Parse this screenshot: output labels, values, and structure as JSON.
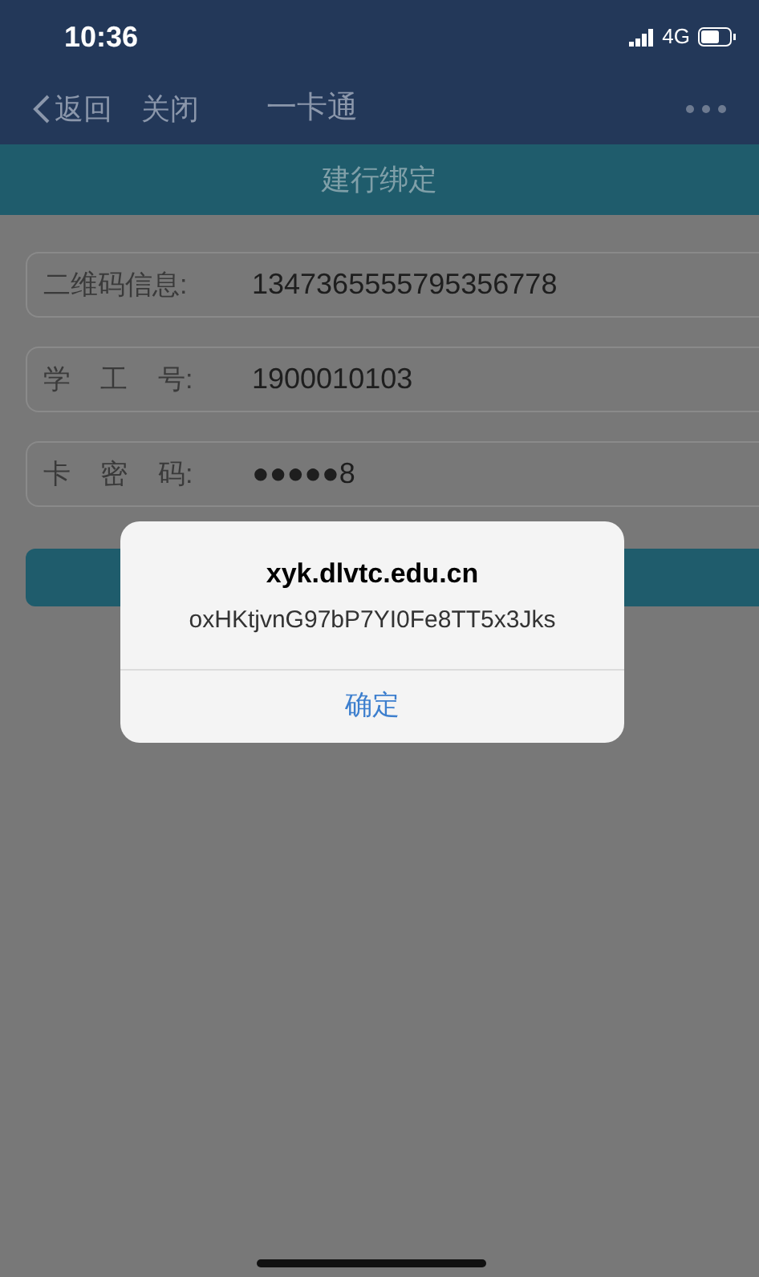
{
  "status_bar": {
    "time": "10:36",
    "network": "4G"
  },
  "nav_bar": {
    "back": "返回",
    "close": "关闭",
    "title": "一卡通"
  },
  "header": {
    "title": "建行绑定"
  },
  "fields": [
    {
      "label": "二维码信息:",
      "value": "1347365555795356778"
    },
    {
      "label": "学 工 号:",
      "value": "1900010103"
    },
    {
      "label": "卡 密 码:",
      "value": "●●●●●8"
    }
  ],
  "dialog": {
    "title": "xyk.dlvtc.edu.cn",
    "message": "oxHKtjvnG97bP7YI0Fe8TT5x3Jks",
    "button": "确定"
  }
}
